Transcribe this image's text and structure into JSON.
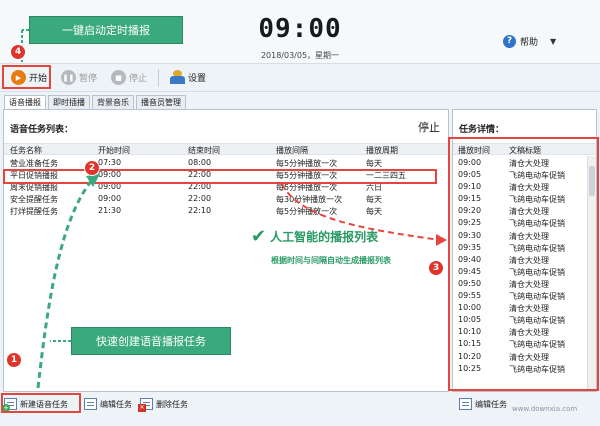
{
  "header": {
    "clock": "09:00",
    "date": "2018/03/05，星期一",
    "help_label": "帮助"
  },
  "toolbar": {
    "start_label": "开始",
    "pause_label": "暂停",
    "stop_label": "停止",
    "settings_label": "设置"
  },
  "tabs": [
    {
      "label": "语音播报",
      "active": true
    },
    {
      "label": "即时插播"
    },
    {
      "label": "背景音乐"
    },
    {
      "label": "播音员管理"
    }
  ],
  "task_list": {
    "title": "语音任务列表：",
    "status": "停止",
    "columns": [
      "任务名称",
      "开始时间",
      "结束时间",
      "播放间隔",
      "播放周期"
    ],
    "rows": [
      [
        "营业准备任务",
        "07:30",
        "08:00",
        "每5分钟播放一次",
        "每天"
      ],
      [
        "平日促销播报",
        "09:00",
        "22:00",
        "每5分钟播放一次",
        "一二三四五"
      ],
      [
        "周末促销播报",
        "09:00",
        "22:00",
        "每5分钟播放一次",
        "六日"
      ],
      [
        "安全提醒任务",
        "09:00",
        "22:00",
        "每30分钟播放一次",
        "每天"
      ],
      [
        "打烊提醒任务",
        "21:30",
        "22:10",
        "每5分钟播放一次",
        "每天"
      ]
    ]
  },
  "detail": {
    "title": "任务详情：",
    "columns": [
      "播放时间",
      "文稿标题"
    ],
    "rows": [
      [
        "09:00",
        "清仓大处理"
      ],
      [
        "09:05",
        "飞鸽电动车促销"
      ],
      [
        "09:10",
        "清仓大处理"
      ],
      [
        "09:15",
        "飞鸽电动车促销"
      ],
      [
        "09:20",
        "清仓大处理"
      ],
      [
        "09:25",
        "飞鸽电动车促销"
      ],
      [
        "09:30",
        "清仓大处理"
      ],
      [
        "09:35",
        "飞鸽电动车促销"
      ],
      [
        "09:40",
        "清仓大处理"
      ],
      [
        "09:45",
        "飞鸽电动车促销"
      ],
      [
        "09:50",
        "清仓大处理"
      ],
      [
        "09:55",
        "飞鸽电动车促销"
      ],
      [
        "10:00",
        "清仓大处理"
      ],
      [
        "10:05",
        "飞鸽电动车促销"
      ],
      [
        "10:10",
        "清仓大处理"
      ],
      [
        "10:15",
        "飞鸽电动车促销"
      ],
      [
        "10:20",
        "清仓大处理"
      ],
      [
        "10:25",
        "飞鸽电动车促销"
      ]
    ]
  },
  "bottom_toolbar": {
    "new_label": "新建语音任务",
    "edit_label": "编辑任务",
    "delete_label": "删除任务",
    "detail_label": "编辑任务"
  },
  "annotations": {
    "top_callout": "一键启动定时播报",
    "bottom_callout": "快速创建语音播报任务",
    "ai_title": "人工智能的播报列表",
    "ai_subtitle": "根据时间与间隔自动生成播报列表",
    "badges": [
      "1",
      "2",
      "3",
      "4"
    ]
  },
  "watermark": "www.downxia.com",
  "colors": {
    "accent_green": "#3aaa7c",
    "highlight_red": "#e5453f",
    "play_orange": "#e67c12"
  }
}
